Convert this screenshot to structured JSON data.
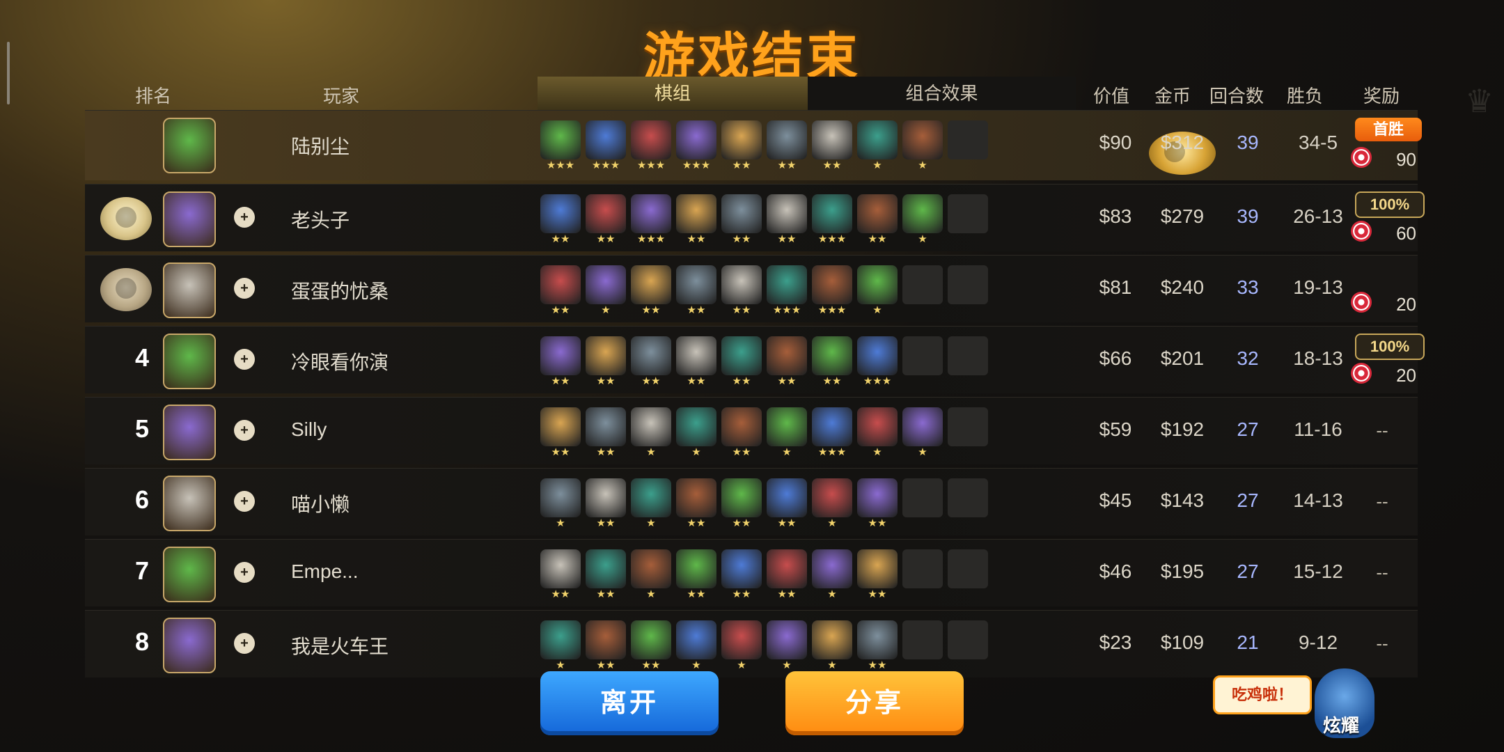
{
  "title": "游戏结束",
  "headers": {
    "rank": "排名",
    "player": "玩家",
    "tab_pieces": "棋组",
    "tab_synergy": "组合效果",
    "value": "价值",
    "gold": "金币",
    "rounds": "回合数",
    "winloss": "胜负",
    "reward": "奖励"
  },
  "buttons": {
    "leave": "离开",
    "share": "分享"
  },
  "bubble": "吃鸡啦！",
  "mascot_label": "炫耀",
  "friend_icon": "+",
  "rows": [
    {
      "rank": "1",
      "name": "陆别尘",
      "value": "$90",
      "gold": "$312",
      "rounds": "39",
      "wl": "34-5",
      "reward": {
        "tag": "首胜",
        "tag_type": "first",
        "count": "90"
      },
      "stars": [
        "★★★",
        "★★★",
        "★★★",
        "★★★",
        "★★",
        "★★",
        "★★",
        "★",
        "★"
      ]
    },
    {
      "rank": "2",
      "name": "老头子",
      "value": "$83",
      "gold": "$279",
      "rounds": "39",
      "wl": "26-13",
      "reward": {
        "tag": "100%",
        "tag_type": "pct",
        "count": "60"
      },
      "stars": [
        "★★",
        "★★",
        "★★★",
        "★★",
        "★★",
        "★★",
        "★★★",
        "★★",
        "★"
      ]
    },
    {
      "rank": "3",
      "name": "蛋蛋的忧桑",
      "value": "$81",
      "gold": "$240",
      "rounds": "33",
      "wl": "19-13",
      "reward": {
        "tag": "",
        "tag_type": "",
        "count": "20"
      },
      "stars": [
        "★★",
        "★",
        "★★",
        "★★",
        "★★",
        "★★★",
        "★★★",
        "★"
      ]
    },
    {
      "rank": "4",
      "name": "冷眼看你演",
      "value": "$66",
      "gold": "$201",
      "rounds": "32",
      "wl": "18-13",
      "reward": {
        "tag": "100%",
        "tag_type": "pct",
        "count": "20"
      },
      "stars": [
        "★★",
        "★★",
        "★★",
        "★★",
        "★★",
        "★★",
        "★★",
        "★★★"
      ]
    },
    {
      "rank": "5",
      "name": "Silly",
      "value": "$59",
      "gold": "$192",
      "rounds": "27",
      "wl": "11-16",
      "reward": {
        "dash": "--"
      },
      "stars": [
        "★★",
        "★★",
        "★",
        "★",
        "★★",
        "★",
        "★★★",
        "★",
        "★"
      ]
    },
    {
      "rank": "6",
      "name": "喵小懒",
      "value": "$45",
      "gold": "$143",
      "rounds": "27",
      "wl": "14-13",
      "reward": {
        "dash": "--"
      },
      "stars": [
        "★",
        "★★",
        "★",
        "★★",
        "★★",
        "★★",
        "★",
        "★★"
      ]
    },
    {
      "rank": "7",
      "name": "Empe...",
      "value": "$46",
      "gold": "$195",
      "rounds": "27",
      "wl": "15-12",
      "reward": {
        "dash": "--"
      },
      "stars": [
        "★★",
        "★★",
        "★",
        "★★",
        "★★",
        "★★",
        "★",
        "★★"
      ]
    },
    {
      "rank": "8",
      "name": "我是火车王",
      "value": "$23",
      "gold": "$109",
      "rounds": "21",
      "wl": "9-12",
      "reward": {
        "dash": "--"
      },
      "stars": [
        "★",
        "★★",
        "★★",
        "★",
        "★",
        "★",
        "★",
        "★★"
      ]
    }
  ],
  "colors": {
    "title": "#ffa21c",
    "rounds": "#a9b8ff",
    "leave": "#1e7ee8",
    "share": "#ff9a1c"
  }
}
